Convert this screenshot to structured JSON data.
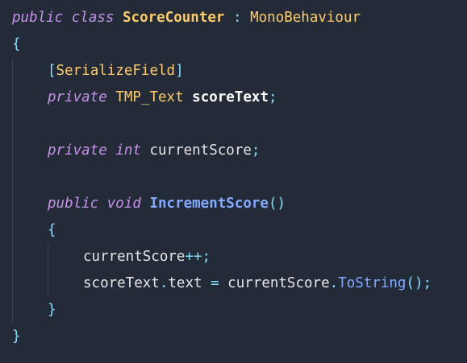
{
  "code": {
    "line1": {
      "kw_public": "public",
      "kw_class": "class",
      "class_name": "ScoreCounter",
      "colon": ":",
      "base_class": "MonoBehaviour"
    },
    "line2": {
      "brace": "{"
    },
    "line3": {
      "lbracket": "[",
      "attribute": "SerializeField",
      "rbracket": "]"
    },
    "line4": {
      "kw_private": "private",
      "type": "TMP_Text",
      "field": "scoreText",
      "semicolon": ";"
    },
    "line6": {
      "kw_private": "private",
      "kw_int": "int",
      "field": "currentScore",
      "semicolon": ";"
    },
    "line8": {
      "kw_public": "public",
      "kw_void": "void",
      "method": "IncrementScore",
      "parens": "()"
    },
    "line9": {
      "brace": "{"
    },
    "line10": {
      "ident": "currentScore",
      "op": "++",
      "semicolon": ";"
    },
    "line11": {
      "object": "scoreText",
      "dot1": ".",
      "member": "text",
      "assign": "=",
      "ident": "currentScore",
      "dot2": ".",
      "call": "ToString",
      "parens": "()",
      "semicolon": ";"
    },
    "line12": {
      "brace": "}"
    },
    "line13": {
      "brace": "}"
    }
  }
}
